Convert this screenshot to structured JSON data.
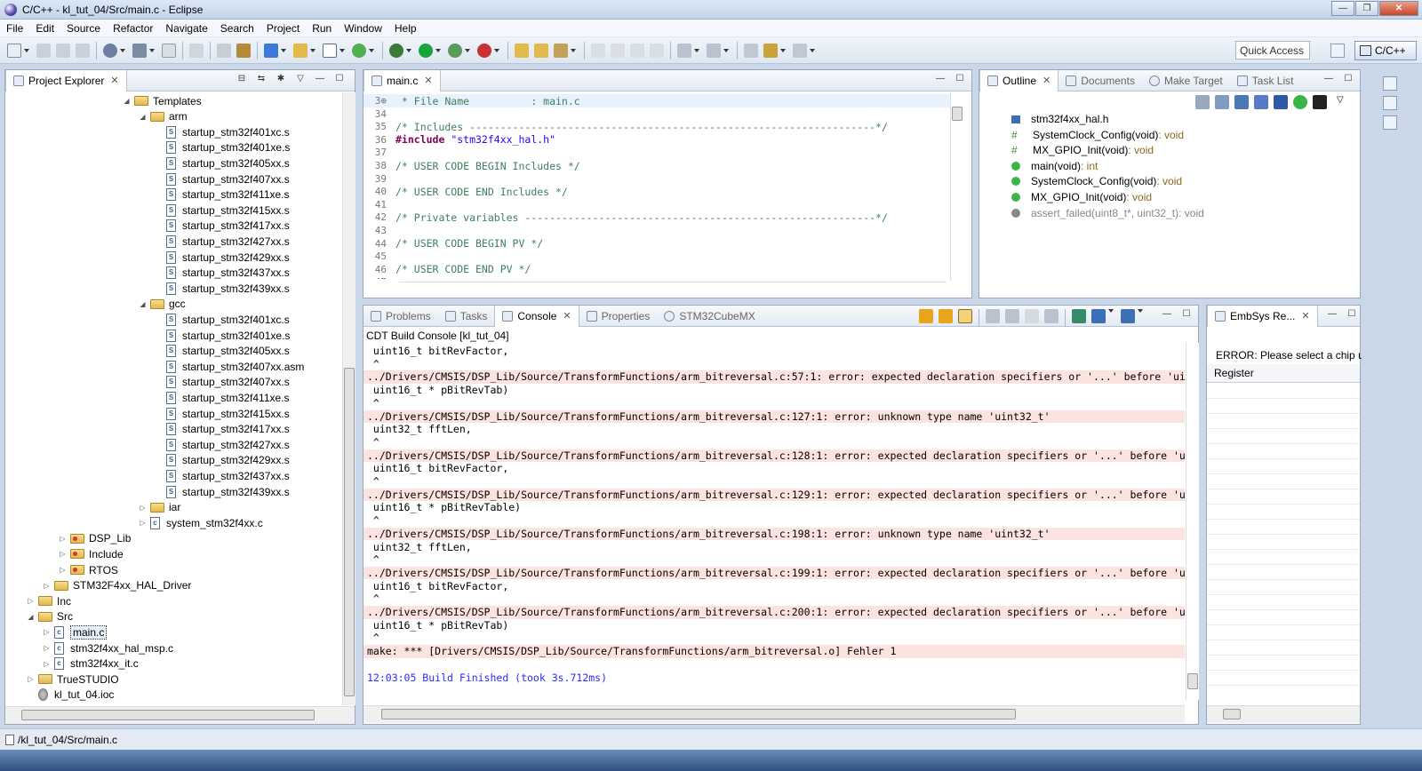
{
  "window": {
    "title": "C/C++ - kl_tut_04/Src/main.c - Eclipse"
  },
  "menu": [
    "File",
    "Edit",
    "Source",
    "Refactor",
    "Navigate",
    "Search",
    "Project",
    "Run",
    "Window",
    "Help"
  ],
  "toolbar": {
    "quick_access": "Quick Access",
    "perspective": "C/C++"
  },
  "project_explorer": {
    "tab": "Project Explorer",
    "tree": [
      {
        "label": "Templates",
        "type": "folder",
        "level": 7,
        "state": "open",
        "top": 0
      },
      {
        "label": "arm",
        "type": "folder",
        "level": 8,
        "state": "open"
      },
      {
        "label": "startup_stm32f401xc.s",
        "type": "file",
        "level": 9
      },
      {
        "label": "startup_stm32f401xe.s",
        "type": "file",
        "level": 9
      },
      {
        "label": "startup_stm32f405xx.s",
        "type": "file",
        "level": 9
      },
      {
        "label": "startup_stm32f407xx.s",
        "type": "file",
        "level": 9
      },
      {
        "label": "startup_stm32f411xe.s",
        "type": "file",
        "level": 9
      },
      {
        "label": "startup_stm32f415xx.s",
        "type": "file",
        "level": 9
      },
      {
        "label": "startup_stm32f417xx.s",
        "type": "file",
        "level": 9
      },
      {
        "label": "startup_stm32f427xx.s",
        "type": "file",
        "level": 9
      },
      {
        "label": "startup_stm32f429xx.s",
        "type": "file",
        "level": 9
      },
      {
        "label": "startup_stm32f437xx.s",
        "type": "file",
        "level": 9
      },
      {
        "label": "startup_stm32f439xx.s",
        "type": "file",
        "level": 9
      },
      {
        "label": "gcc",
        "type": "folder",
        "level": 8,
        "state": "open"
      },
      {
        "label": "startup_stm32f401xc.s",
        "type": "file",
        "level": 9
      },
      {
        "label": "startup_stm32f401xe.s",
        "type": "file",
        "level": 9
      },
      {
        "label": "startup_stm32f405xx.s",
        "type": "file",
        "level": 9
      },
      {
        "label": "startup_stm32f407xx.asm",
        "type": "file",
        "level": 9
      },
      {
        "label": "startup_stm32f407xx.s",
        "type": "file",
        "level": 9
      },
      {
        "label": "startup_stm32f411xe.s",
        "type": "file",
        "level": 9
      },
      {
        "label": "startup_stm32f415xx.s",
        "type": "file",
        "level": 9
      },
      {
        "label": "startup_stm32f417xx.s",
        "type": "file",
        "level": 9
      },
      {
        "label": "startup_stm32f427xx.s",
        "type": "file",
        "level": 9
      },
      {
        "label": "startup_stm32f429xx.s",
        "type": "file",
        "level": 9
      },
      {
        "label": "startup_stm32f437xx.s",
        "type": "file",
        "level": 9
      },
      {
        "label": "startup_stm32f439xx.s",
        "type": "file",
        "level": 9
      },
      {
        "label": "iar",
        "type": "folder",
        "level": 8,
        "state": "closed"
      },
      {
        "label": "system_stm32f4xx.c",
        "type": "cfile",
        "level": 8,
        "state": "closed"
      },
      {
        "label": "DSP_Lib",
        "type": "folder-red",
        "level": 3,
        "state": "closed"
      },
      {
        "label": "Include",
        "type": "folder-red",
        "level": 3,
        "state": "closed"
      },
      {
        "label": "RTOS",
        "type": "folder-red",
        "level": 3,
        "state": "closed"
      },
      {
        "label": "STM32F4xx_HAL_Driver",
        "type": "folder",
        "level": 2,
        "state": "closed"
      },
      {
        "label": "Inc",
        "type": "folder",
        "level": 1,
        "state": "closed"
      },
      {
        "label": "Src",
        "type": "folder",
        "level": 1,
        "state": "open"
      },
      {
        "label": "main.c",
        "type": "cfile",
        "level": 2,
        "state": "closed",
        "selected": true
      },
      {
        "label": "stm32f4xx_hal_msp.c",
        "type": "cfile",
        "level": 2,
        "state": "closed"
      },
      {
        "label": "stm32f4xx_it.c",
        "type": "cfile",
        "level": 2,
        "state": "closed"
      },
      {
        "label": "TrueSTUDIO",
        "type": "folder",
        "level": 1,
        "state": "closed"
      },
      {
        "label": "kl_tut_04.ioc",
        "type": "ioc",
        "level": 1
      }
    ]
  },
  "editor": {
    "tab": "main.c",
    "lines": [
      {
        "n": "3⊕",
        "text": " * File Name          : main.c",
        "kind": "comment",
        "current": true
      },
      {
        "n": "34",
        "text": "",
        "kind": "comment"
      },
      {
        "n": "35",
        "text": "/* Includes ------------------------------------------------------------------*/",
        "kind": "comment"
      },
      {
        "n": "36",
        "text": "#include \"stm32f4xx_hal.h\"",
        "kind": "include"
      },
      {
        "n": "37",
        "text": "",
        "kind": "comment"
      },
      {
        "n": "38",
        "text": "/* USER CODE BEGIN Includes */",
        "kind": "comment"
      },
      {
        "n": "39",
        "text": "",
        "kind": "comment"
      },
      {
        "n": "40",
        "text": "/* USER CODE END Includes */",
        "kind": "comment"
      },
      {
        "n": "41",
        "text": "",
        "kind": "comment"
      },
      {
        "n": "42",
        "text": "/* Private variables ---------------------------------------------------------*/",
        "kind": "comment"
      },
      {
        "n": "43",
        "text": "",
        "kind": "comment"
      },
      {
        "n": "44",
        "text": "/* USER CODE BEGIN PV */",
        "kind": "comment"
      },
      {
        "n": "45",
        "text": "",
        "kind": "comment"
      },
      {
        "n": "46",
        "text": "/* USER CODE END PV */",
        "kind": "comment"
      },
      {
        "n": "47",
        "text": "",
        "kind": "comment"
      }
    ]
  },
  "outline": {
    "tabs": [
      "Outline",
      "Documents",
      "Make Target",
      "Task List"
    ],
    "items": [
      {
        "name": "stm32f4xx_hal.h",
        "type": "",
        "icon": "include-icon"
      },
      {
        "name": "SystemClock_Config(void)",
        "type": " : void",
        "icon": "prototype-icon"
      },
      {
        "name": "MX_GPIO_Init(void)",
        "type": " : void",
        "icon": "static-prototype-icon"
      },
      {
        "name": "main(void)",
        "type": " : int",
        "icon": "function-icon"
      },
      {
        "name": "SystemClock_Config(void)",
        "type": " : void",
        "icon": "function-icon"
      },
      {
        "name": "MX_GPIO_Init(void)",
        "type": " : void",
        "icon": "function-icon"
      },
      {
        "name": "assert_failed(uint8_t*, uint32_t)",
        "type": " : void",
        "icon": "excluded-function-icon",
        "grey": true
      }
    ]
  },
  "console": {
    "tabs": [
      "Problems",
      "Tasks",
      "Console",
      "Properties",
      "STM32CubeMX"
    ],
    "title": "CDT Build Console [kl_tut_04]",
    "lines": [
      {
        "text": " uint16_t bitRevFactor,",
        "kind": "plain"
      },
      {
        "text": " ^",
        "kind": "plain"
      },
      {
        "text": "../Drivers/CMSIS/DSP_Lib/Source/TransformFunctions/arm_bitreversal.c:57:1: error: expected declaration specifiers or '...' before 'uin",
        "kind": "err"
      },
      {
        "text": " uint16_t * pBitRevTab)",
        "kind": "plain"
      },
      {
        "text": " ^",
        "kind": "plain"
      },
      {
        "text": "../Drivers/CMSIS/DSP_Lib/Source/TransformFunctions/arm_bitreversal.c:127:1: error: unknown type name 'uint32_t'",
        "kind": "err"
      },
      {
        "text": " uint32_t fftLen,",
        "kind": "plain"
      },
      {
        "text": " ^",
        "kind": "plain"
      },
      {
        "text": "../Drivers/CMSIS/DSP_Lib/Source/TransformFunctions/arm_bitreversal.c:128:1: error: expected declaration specifiers or '...' before 'ui",
        "kind": "err"
      },
      {
        "text": " uint16_t bitRevFactor,",
        "kind": "plain"
      },
      {
        "text": " ^",
        "kind": "plain"
      },
      {
        "text": "../Drivers/CMSIS/DSP_Lib/Source/TransformFunctions/arm_bitreversal.c:129:1: error: expected declaration specifiers or '...' before 'ui",
        "kind": "err"
      },
      {
        "text": " uint16_t * pBitRevTable)",
        "kind": "plain"
      },
      {
        "text": " ^",
        "kind": "plain"
      },
      {
        "text": "../Drivers/CMSIS/DSP_Lib/Source/TransformFunctions/arm_bitreversal.c:198:1: error: unknown type name 'uint32_t'",
        "kind": "err"
      },
      {
        "text": " uint32_t fftLen,",
        "kind": "plain"
      },
      {
        "text": " ^",
        "kind": "plain"
      },
      {
        "text": "../Drivers/CMSIS/DSP_Lib/Source/TransformFunctions/arm_bitreversal.c:199:1: error: expected declaration specifiers or '...' before 'ui",
        "kind": "err"
      },
      {
        "text": " uint16_t bitRevFactor,",
        "kind": "plain"
      },
      {
        "text": " ^",
        "kind": "plain"
      },
      {
        "text": "../Drivers/CMSIS/DSP_Lib/Source/TransformFunctions/arm_bitreversal.c:200:1: error: expected declaration specifiers or '...' before 'ui",
        "kind": "err"
      },
      {
        "text": " uint16_t * pBitRevTab)",
        "kind": "plain"
      },
      {
        "text": " ^",
        "kind": "plain"
      },
      {
        "text": "make: *** [Drivers/CMSIS/DSP_Lib/Source/TransformFunctions/arm_bitreversal.o] Fehler 1",
        "kind": "err"
      },
      {
        "text": "",
        "kind": "plain"
      },
      {
        "text": "12:03:05 Build Finished (took 3s.712ms)",
        "kind": "fin"
      }
    ]
  },
  "embsys": {
    "tab": "EmbSys Re...",
    "error": "ERROR: Please select a chip u",
    "column": "Register"
  },
  "statusbar": {
    "path": "/kl_tut_04/Src/main.c"
  }
}
